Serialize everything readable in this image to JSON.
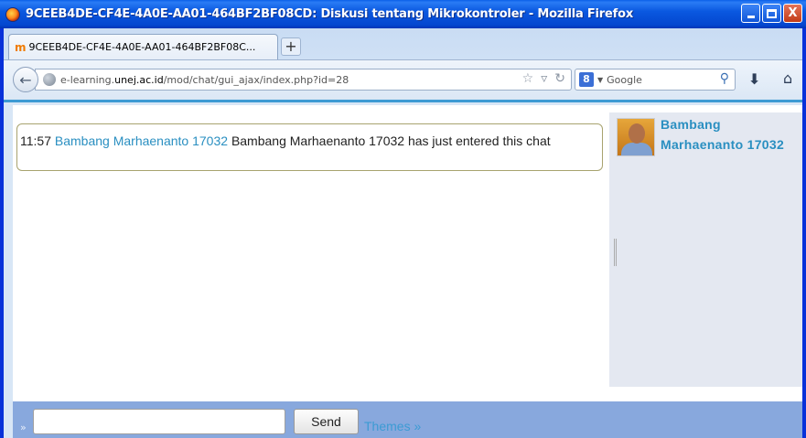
{
  "window": {
    "title": "9CEEB4DE-CF4E-4A0E-AA01-464BF2BF08CD: Diskusi tentang Mikrokontroler - Mozilla Firefox",
    "minimize_glyph": "",
    "maximize_glyph": "",
    "close_glyph": "X"
  },
  "tabs": [
    {
      "favicon": "m",
      "label": "9CEEB4DE-CF4E-4A0E-AA01-464BF2BF08C..."
    }
  ],
  "newtab_glyph": "+",
  "navbar": {
    "url_prefix": "e-learning.",
    "url_domain": "unej.ac.id",
    "url_path": "/mod/chat/gui_ajax/index.php?id=28",
    "search_engine_letter": "8",
    "search_placeholder": "Google"
  },
  "chat": {
    "messages": [
      {
        "time": "11:57",
        "user": "Bambang Marhaenanto 17032",
        "text": "Bambang Marhaenanto 17032 has just entered this chat"
      }
    ],
    "users": [
      {
        "name": "Bambang Marhaenanto 17032"
      }
    ],
    "input": {
      "value": "",
      "prompt": "»"
    },
    "send_label": "Send",
    "themes_label": "Themes »"
  },
  "colors": {
    "link": "#2a8fc1",
    "input_bar": "#88a8dd",
    "user_panel": "#e4e8f1"
  }
}
